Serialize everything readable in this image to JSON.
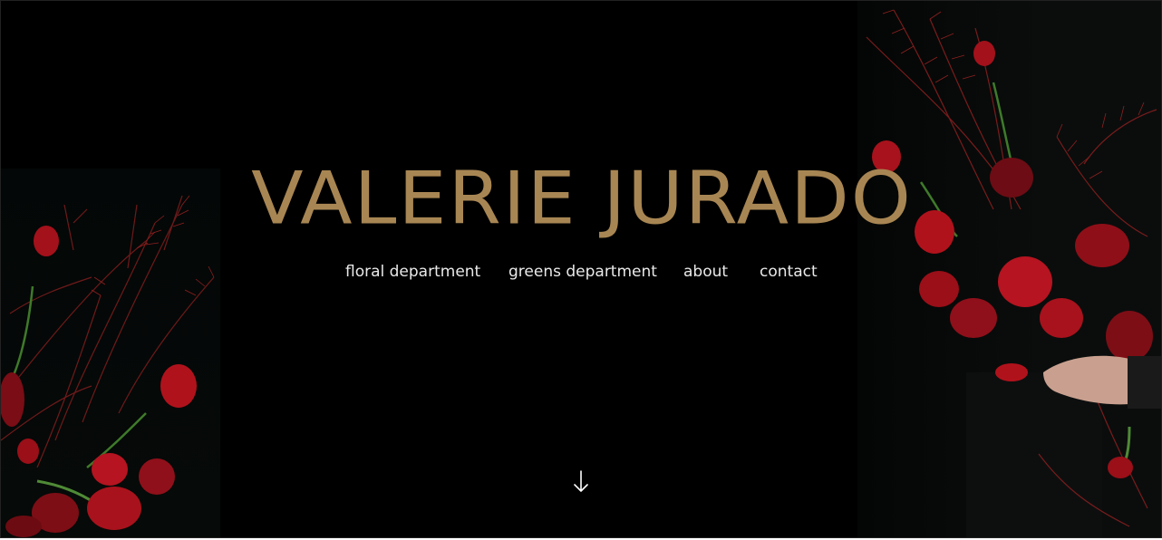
{
  "brand": {
    "name": "VALERIE JURADO",
    "color": "#a88653"
  },
  "nav": {
    "items": [
      {
        "label": "floral department"
      },
      {
        "label": "greens department"
      },
      {
        "label": "about"
      },
      {
        "label": "contact"
      }
    ]
  },
  "scroll": {
    "icon": "arrow-down-icon"
  },
  "colors": {
    "background": "#000000",
    "accent": "#a88653",
    "flower": "#b0121c",
    "foliage": "#7a1a1a"
  }
}
